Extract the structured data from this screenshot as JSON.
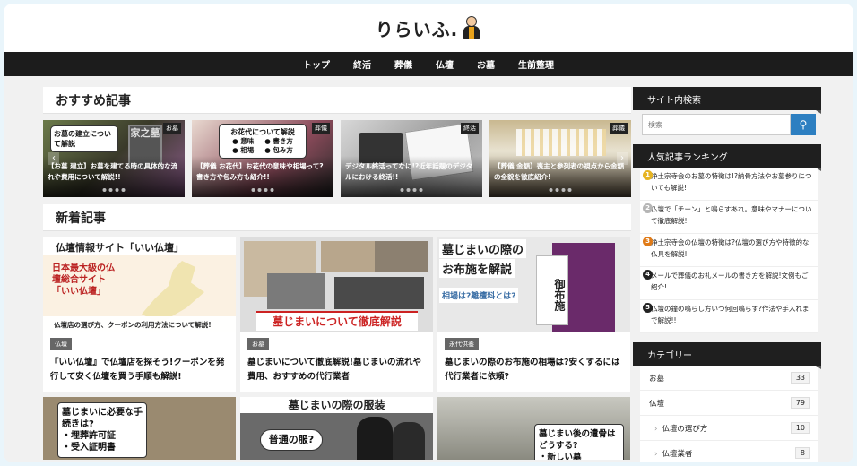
{
  "site": {
    "logo_text": "りらいふ."
  },
  "nav": [
    "トップ",
    "終活",
    "葬儀",
    "仏壇",
    "お墓",
    "生前整理"
  ],
  "recommended": {
    "heading": "おすすめ記事",
    "items": [
      {
        "tag": "お墓",
        "box": "お墓の建立について解説",
        "caption": "【お墓 建立】お墓を建てる時の具体的な流れや費用について解説!!"
      },
      {
        "tag": "葬儀",
        "box": "お花代について解説",
        "box_list": [
          "意味",
          "相場",
          "書き方",
          "包み方"
        ],
        "caption": "【葬儀 お花代】お花代の意味や相場って?書き方や包み方も紹介!!"
      },
      {
        "tag": "終活",
        "caption": "デジタル終活ってなに!?近年話題のデジタルにおける終活!!"
      },
      {
        "tag": "葬儀",
        "caption": "【葬儀 金額】喪主と参列者の視点から金額の全貌を徹底紹介!"
      }
    ]
  },
  "new_posts": {
    "heading": "新着記事",
    "cards": [
      {
        "thumb_title": "仏壇情報サイト「いい仏壇」",
        "thumb_sub": "日本最大級の仏壇総合サイト「いい仏壇」",
        "thumb_caption": "仏壇店の選び方、クーポンの利用方法について解説!",
        "category": "仏壇",
        "title": "『いい仏壇』で仏壇店を探そう!クーポンを発行して安く仏壇を買う手順も解説!"
      },
      {
        "thumb_caption": "墓じまいについて徹底解説",
        "category": "お墓",
        "title": "墓じまいについて徹底解説!墓じまいの流れや費用、おすすめの代行業者"
      },
      {
        "thumb_line1": "墓じまいの際の",
        "thumb_line2": "お布施を解説",
        "thumb_line3": "相場は?離檀料とは?",
        "thumb_envelope": "御布施",
        "category": "永代供養",
        "title": "墓じまいの際のお布施の相場は?安くするには代行業者に依頼?"
      }
    ],
    "partial": [
      {
        "text": "墓じまいに必要な手続きは?",
        "list": [
          "・埋葬許可証",
          "・受入証明書"
        ]
      },
      {
        "top": "墓じまいの際の服装",
        "bubble": "普通の服?"
      },
      {
        "text": "墓じまい後の遺骨はどうする?",
        "sub": "・新しい墓"
      }
    ]
  },
  "sidebar": {
    "search_title": "サイト内検索",
    "search_placeholder": "検索",
    "ranking_title": "人気記事ランキング",
    "ranking": [
      {
        "num": "1",
        "color": "#e6b422",
        "text": "浄土宗寺会のお墓の特徴は!?納骨方法やお墓参りについても解説!!"
      },
      {
        "num": "2",
        "color": "#b5b5b5",
        "text": "仏壇で「チーン」と鳴らすあれ。意味やマナーについて徹底解説!"
      },
      {
        "num": "3",
        "color": "#e07b18",
        "text": "浄土宗寺会の仏壇の特徴は?仏壇の選び方や特徴的な仏具を解説!"
      },
      {
        "num": "4",
        "color": "#222222",
        "text": "メールで葬儀のお礼メールの書き方を解説!文例もご紹介!"
      },
      {
        "num": "5",
        "color": "#222222",
        "text": "仏壇の鐘の鳴らし方いつ何回鳴らす?作法や手入れまで解説!!"
      }
    ],
    "category_title": "カテゴリー",
    "categories": [
      {
        "name": "お墓",
        "count": "33",
        "sub": false
      },
      {
        "name": "仏壇",
        "count": "79",
        "sub": false
      },
      {
        "name": "仏壇の選び方",
        "count": "10",
        "sub": true
      },
      {
        "name": "仏壇業者",
        "count": "8",
        "sub": true
      }
    ]
  }
}
